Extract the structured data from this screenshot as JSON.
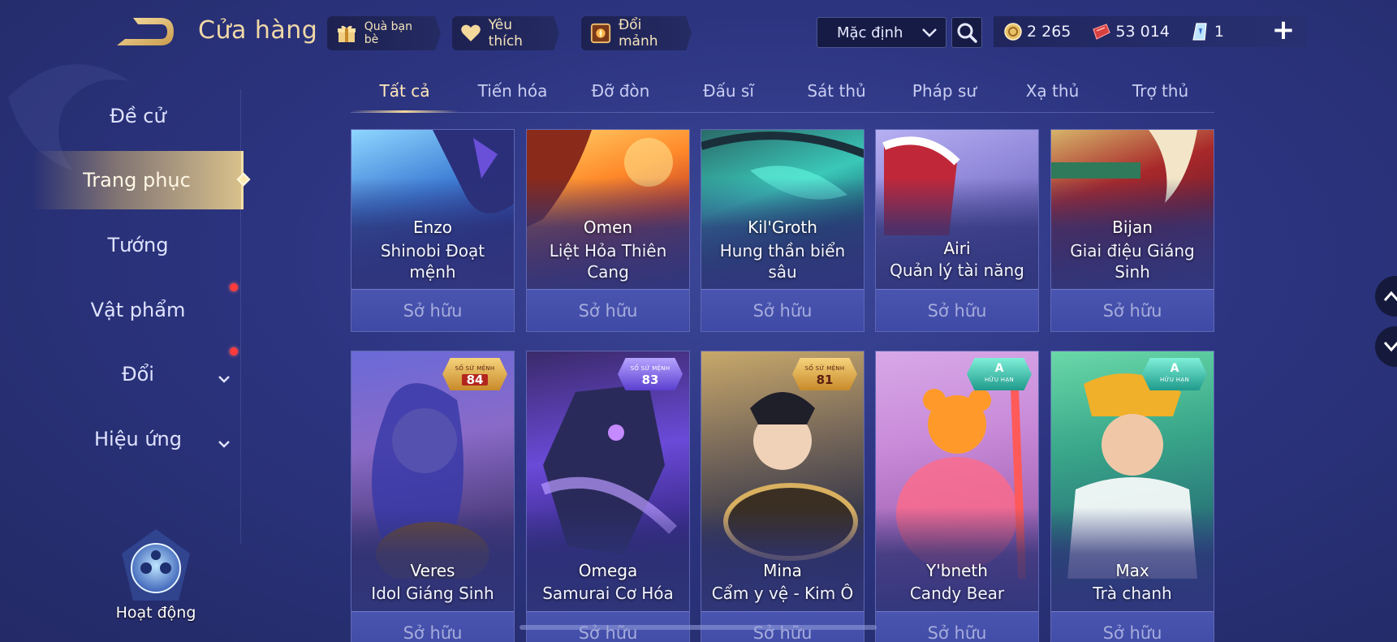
{
  "header": {
    "title": "Cửa hàng",
    "gift_label": "Quà bạn bè",
    "favorite_label": "Yêu thích",
    "exchange_label": "Đổi mảnh",
    "sort_value": "Mặc định",
    "currencies": [
      {
        "name": "gold-coin-icon",
        "value": "2 265"
      },
      {
        "name": "voucher-icon",
        "value": "53 014"
      },
      {
        "name": "crystal-icon",
        "value": "1"
      }
    ]
  },
  "sidebar": {
    "items": [
      {
        "label": "Đề cử"
      },
      {
        "label": "Trang phục"
      },
      {
        "label": "Tướng"
      },
      {
        "label": "Vật phẩm"
      },
      {
        "label": "Đổi"
      },
      {
        "label": "Hiệu ứng"
      }
    ],
    "activity_label": "Hoạt động"
  },
  "tabs": [
    {
      "label": "Tất cả"
    },
    {
      "label": "Tiến hóa"
    },
    {
      "label": "Đỡ đòn"
    },
    {
      "label": "Đấu sĩ"
    },
    {
      "label": "Sát thủ"
    },
    {
      "label": "Pháp sư"
    },
    {
      "label": "Xạ thủ"
    },
    {
      "label": "Trợ thủ"
    }
  ],
  "cards_row1": [
    {
      "hero": "Enzo",
      "skin": "Shinobi Đoạt mệnh",
      "status": "Sở hữu"
    },
    {
      "hero": "Omen",
      "skin": "Liệt Hỏa Thiên Cang",
      "status": "Sở hữu"
    },
    {
      "hero": "Kil'Groth",
      "skin": "Hung thần biển sâu",
      "status": "Sở hữu"
    },
    {
      "hero": "Airi",
      "skin": "Quản lý tài năng",
      "status": "Sở hữu"
    },
    {
      "hero": "Bijan",
      "skin": "Giai điệu Giáng Sinh",
      "status": "Sở hữu"
    }
  ],
  "cards_row2": [
    {
      "hero": "Veres",
      "skin": "Idol Giáng Sinh",
      "status": "Sở hữu",
      "badge_caption": "SỐ SỨ MỆNH",
      "badge_value": "84"
    },
    {
      "hero": "Omega",
      "skin": "Samurai Cơ Hóa",
      "status": "Sở hữu",
      "badge_caption": "SỐ SỨ MỆNH",
      "badge_value": "83"
    },
    {
      "hero": "Mina",
      "skin": "Cẩm y vệ - Kim Ô",
      "status": "Sở hữu",
      "badge_caption": "SỐ SỨ MỆNH",
      "badge_value": "81"
    },
    {
      "hero": "Y'bneth",
      "skin": "Candy Bear",
      "status": "Sở hữu",
      "badge_caption": "HỮU HẠN",
      "badge_value": "A"
    },
    {
      "hero": "Max",
      "skin": "Trà chanh",
      "status": "Sở hữu",
      "badge_caption": "HỮU HẠN",
      "badge_value": "A"
    }
  ],
  "colors": {
    "accent_gold": "#f4d89c",
    "background": "#2c3480",
    "badge_red": "#b3261e",
    "notification_dot": "#ff3b3b"
  }
}
